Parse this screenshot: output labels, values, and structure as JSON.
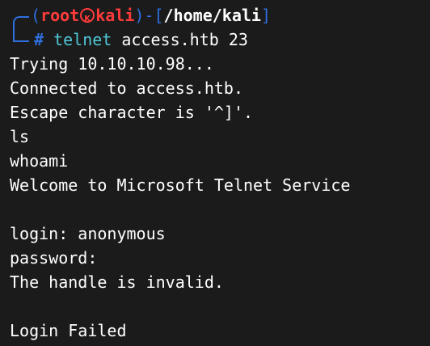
{
  "prompt": {
    "open_paren": "(",
    "user": "root",
    "host": "kali",
    "close_paren": ")",
    "dash": "-",
    "open_bracket": "[",
    "path": "/home/kali",
    "close_bracket": "]",
    "symbol": "#",
    "command": "telnet",
    "args": "access.htb 23"
  },
  "output": [
    "Trying 10.10.10.98...",
    "Connected to access.htb.",
    "Escape character is '^]'.",
    "ls",
    "whoami",
    "Welcome to Microsoft Telnet Service",
    "",
    "login: anonymous",
    "password:",
    "The handle is invalid.",
    "",
    "Login Failed"
  ],
  "colors": {
    "background": "#1b1b1b",
    "prompt_frame": "#2e6fe0",
    "user_host": "#ff3b3b",
    "command": "#4fc7d8",
    "text": "#ffffff"
  }
}
